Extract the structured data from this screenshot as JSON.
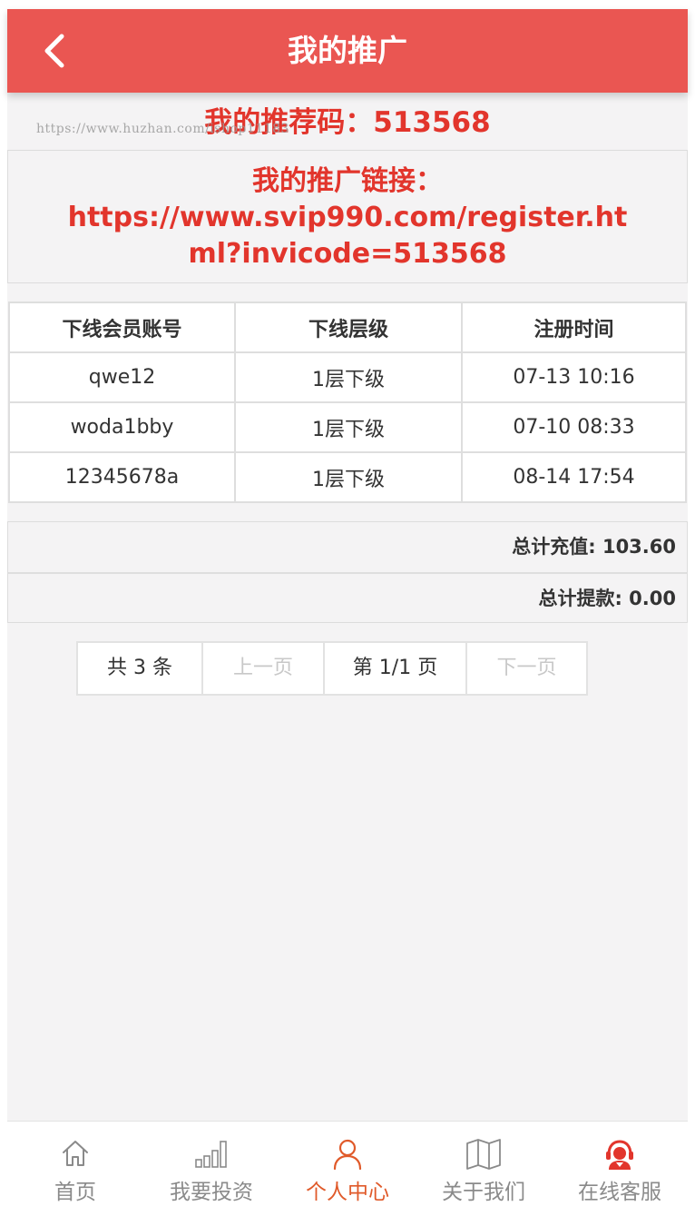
{
  "header": {
    "title": "我的推广",
    "back_icon": "chevron-left-icon"
  },
  "watermark": "https://www.huzhan.com/ishop11183",
  "referral": {
    "code_text": "我的推荐码：513568",
    "link_label": "我的推广链接：",
    "link_url": "https://www.svip990.com/register.html?invicode=513568"
  },
  "table": {
    "headers": [
      "下线会员账号",
      "下线层级",
      "注册时间"
    ],
    "rows": [
      [
        "qwe12",
        "1层下级",
        "07-13 10:16"
      ],
      [
        "woda1bby",
        "1层下级",
        "07-10 08:33"
      ],
      [
        "12345678a",
        "1层下级",
        "08-14 17:54"
      ]
    ]
  },
  "totals": {
    "recharge": "总计充值: 103.60",
    "withdraw": "总计提款: 0.00"
  },
  "pager": {
    "count": "共 3 条",
    "prev": "上一页",
    "page": "第 1/1 页",
    "next": "下一页"
  },
  "tabbar": {
    "active_color": "#e05a2a",
    "items": [
      {
        "label": "首页",
        "icon": "home-icon"
      },
      {
        "label": "我要投资",
        "icon": "bar-chart-icon"
      },
      {
        "label": "个人中心",
        "icon": "user-icon",
        "active": true
      },
      {
        "label": "关于我们",
        "icon": "map-book-icon"
      },
      {
        "label": "在线客服",
        "icon": "customer-service-icon"
      }
    ]
  },
  "colors": {
    "header_bg": "#ea5652",
    "accent_red": "#e2352c",
    "page_bg": "#f4f3f4"
  }
}
